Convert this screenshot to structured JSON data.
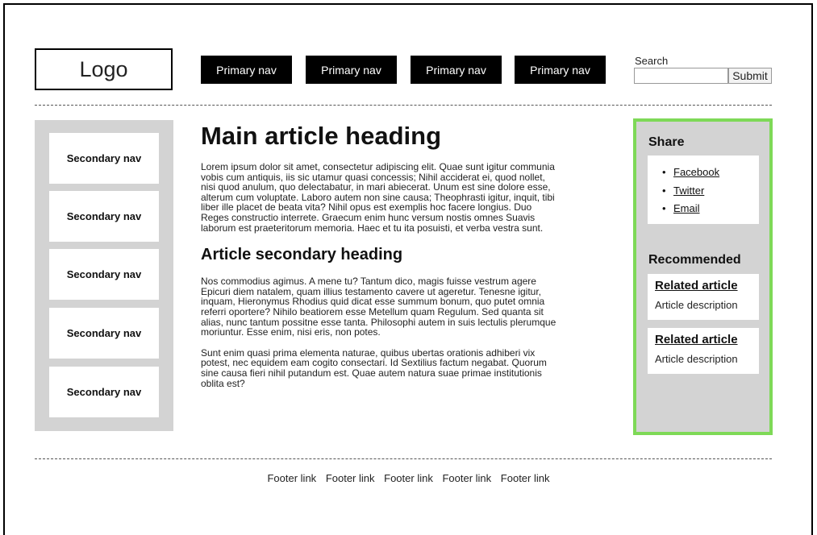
{
  "header": {
    "logo": "Logo",
    "primary_nav": [
      "Primary nav",
      "Primary nav",
      "Primary nav",
      "Primary nav"
    ],
    "search": {
      "label": "Search",
      "value": "",
      "submit_label": "Submit"
    }
  },
  "secondary_nav": [
    "Secondary nav",
    "Secondary nav",
    "Secondary nav",
    "Secondary nav",
    "Secondary nav"
  ],
  "article": {
    "heading": "Main article heading",
    "intro_lines": [
      "Lorem ipsum dolor sit amet, consectetur adipiscing elit. Quae sunt igitur communia",
      "vobis cum antiquis, iis sic utamur quasi concessis; Nihil acciderat ei, quod nollet,",
      "nisi quod anulum, quo delectabatur, in mari abiecerat. Unum est sine dolore esse,",
      "alterum cum voluptate. Laboro autem non sine causa; Theophrasti igitur, inquit, tibi",
      "liber ille placet de beata vita? Nihil opus est exemplis hoc facere longius. Duo",
      "Reges constructio interrete. Graecum enim hunc versum nostis omnes Suavis",
      "laborum est praeteritorum memoria. Haec et tu ita posuisti, et verba vestra sunt."
    ],
    "secondary_heading": "Article secondary heading",
    "para2_lines": [
      "Nos commodius agimus. A mene tu? Tantum dico, magis fuisse vestrum agere",
      "Epicuri diem natalem, quam illius testamento cavere ut ageretur. Tenesne igitur,",
      "inquam, Hieronymus Rhodius quid dicat esse summum bonum, quo putet omnia",
      "referri oportere? Nihilo beatiorem esse Metellum quam Regulum. Sed quanta sit",
      "alias, nunc tantum possitne esse tanta. Philosophi autem in suis lectulis plerumque",
      "moriuntur. Esse enim, nisi eris, non potes."
    ],
    "para3_lines": [
      "Sunt enim quasi prima elementa naturae, quibus ubertas orationis adhiberi vix",
      "potest, nec equidem eam cogito consectari. Id Sextilius factum negabat. Quorum",
      "sine causa fieri nihil putandum est. Quae autem natura suae primae institutionis",
      "oblita est?"
    ]
  },
  "share": {
    "title": "Share",
    "links": [
      "Facebook",
      "Twitter",
      "Email"
    ]
  },
  "recommended": {
    "title": "Recommended",
    "items": [
      {
        "title": "Related article",
        "description": "Article description"
      },
      {
        "title": "Related article",
        "description": "Article description"
      }
    ]
  },
  "footer": {
    "links": [
      "Footer link",
      "Footer link",
      "Footer link",
      "Footer link",
      "Footer link"
    ]
  },
  "colors": {
    "nav_bg": "#000000",
    "sidebar_bg": "#d3d3d3",
    "accent_border": "#7ed957"
  }
}
